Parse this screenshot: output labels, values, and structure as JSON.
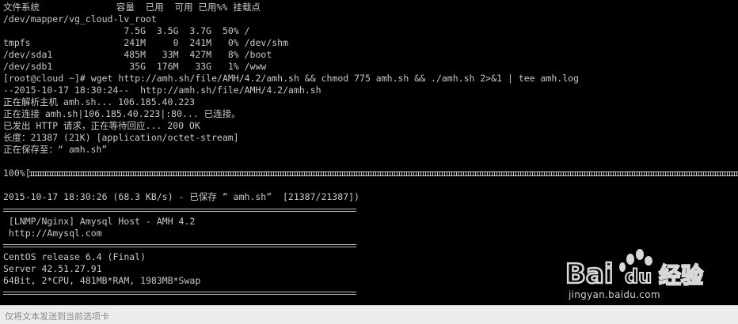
{
  "terminal": {
    "lines": [
      "文件系统              容量  已用  可用 已用%% 挂载点",
      "/dev/mapper/vg_cloud-lv_root",
      "                      7.5G  3.5G  3.7G  50% /",
      "tmpfs                 241M     0  241M   0% /dev/shm",
      "/dev/sda1             485M   33M  427M   8% /boot",
      "/dev/sdb1              35G  176M   33G   1% /www",
      "[root@cloud ~]# wget http://amh.sh/file/AMH/4.2/amh.sh && chmod 775 amh.sh && ./amh.sh 2>&1 | tee amh.log",
      "--2015-10-17 18:30:24--  http://amh.sh/file/AMH/4.2/amh.sh",
      "正在解析主机 amh.sh... 106.185.40.223",
      "正在连接 amh.sh|106.185.40.223|:80... 已连接。",
      "已发出 HTTP 请求，正在等待回应... 200 OK",
      "长度：21387 (21K) [application/octet-stream]",
      "正在保存至：“ amh.sh”",
      "",
      "100%[",
      "",
      "2015-10-17 18:30:26 (68.3 KB/s) - 已保存 “ amh.sh”  [21387/21387])",
      "",
      " [LNMP/Nginx] Amysql Host - AMH 4.2",
      " http://Amysql.com",
      "",
      "CentOS release 6.4 (Final)",
      "Server 42.51.27.91",
      "64Bit, 2*CPU, 481MB*RAM, 1983MB*Swap"
    ],
    "progress_percent": 100
  },
  "input_bar": {
    "hint": "仅将文本发送到当前选项卡"
  },
  "watermark": {
    "brand": "Baidu经验",
    "url": "jingyan.baidu.com"
  }
}
